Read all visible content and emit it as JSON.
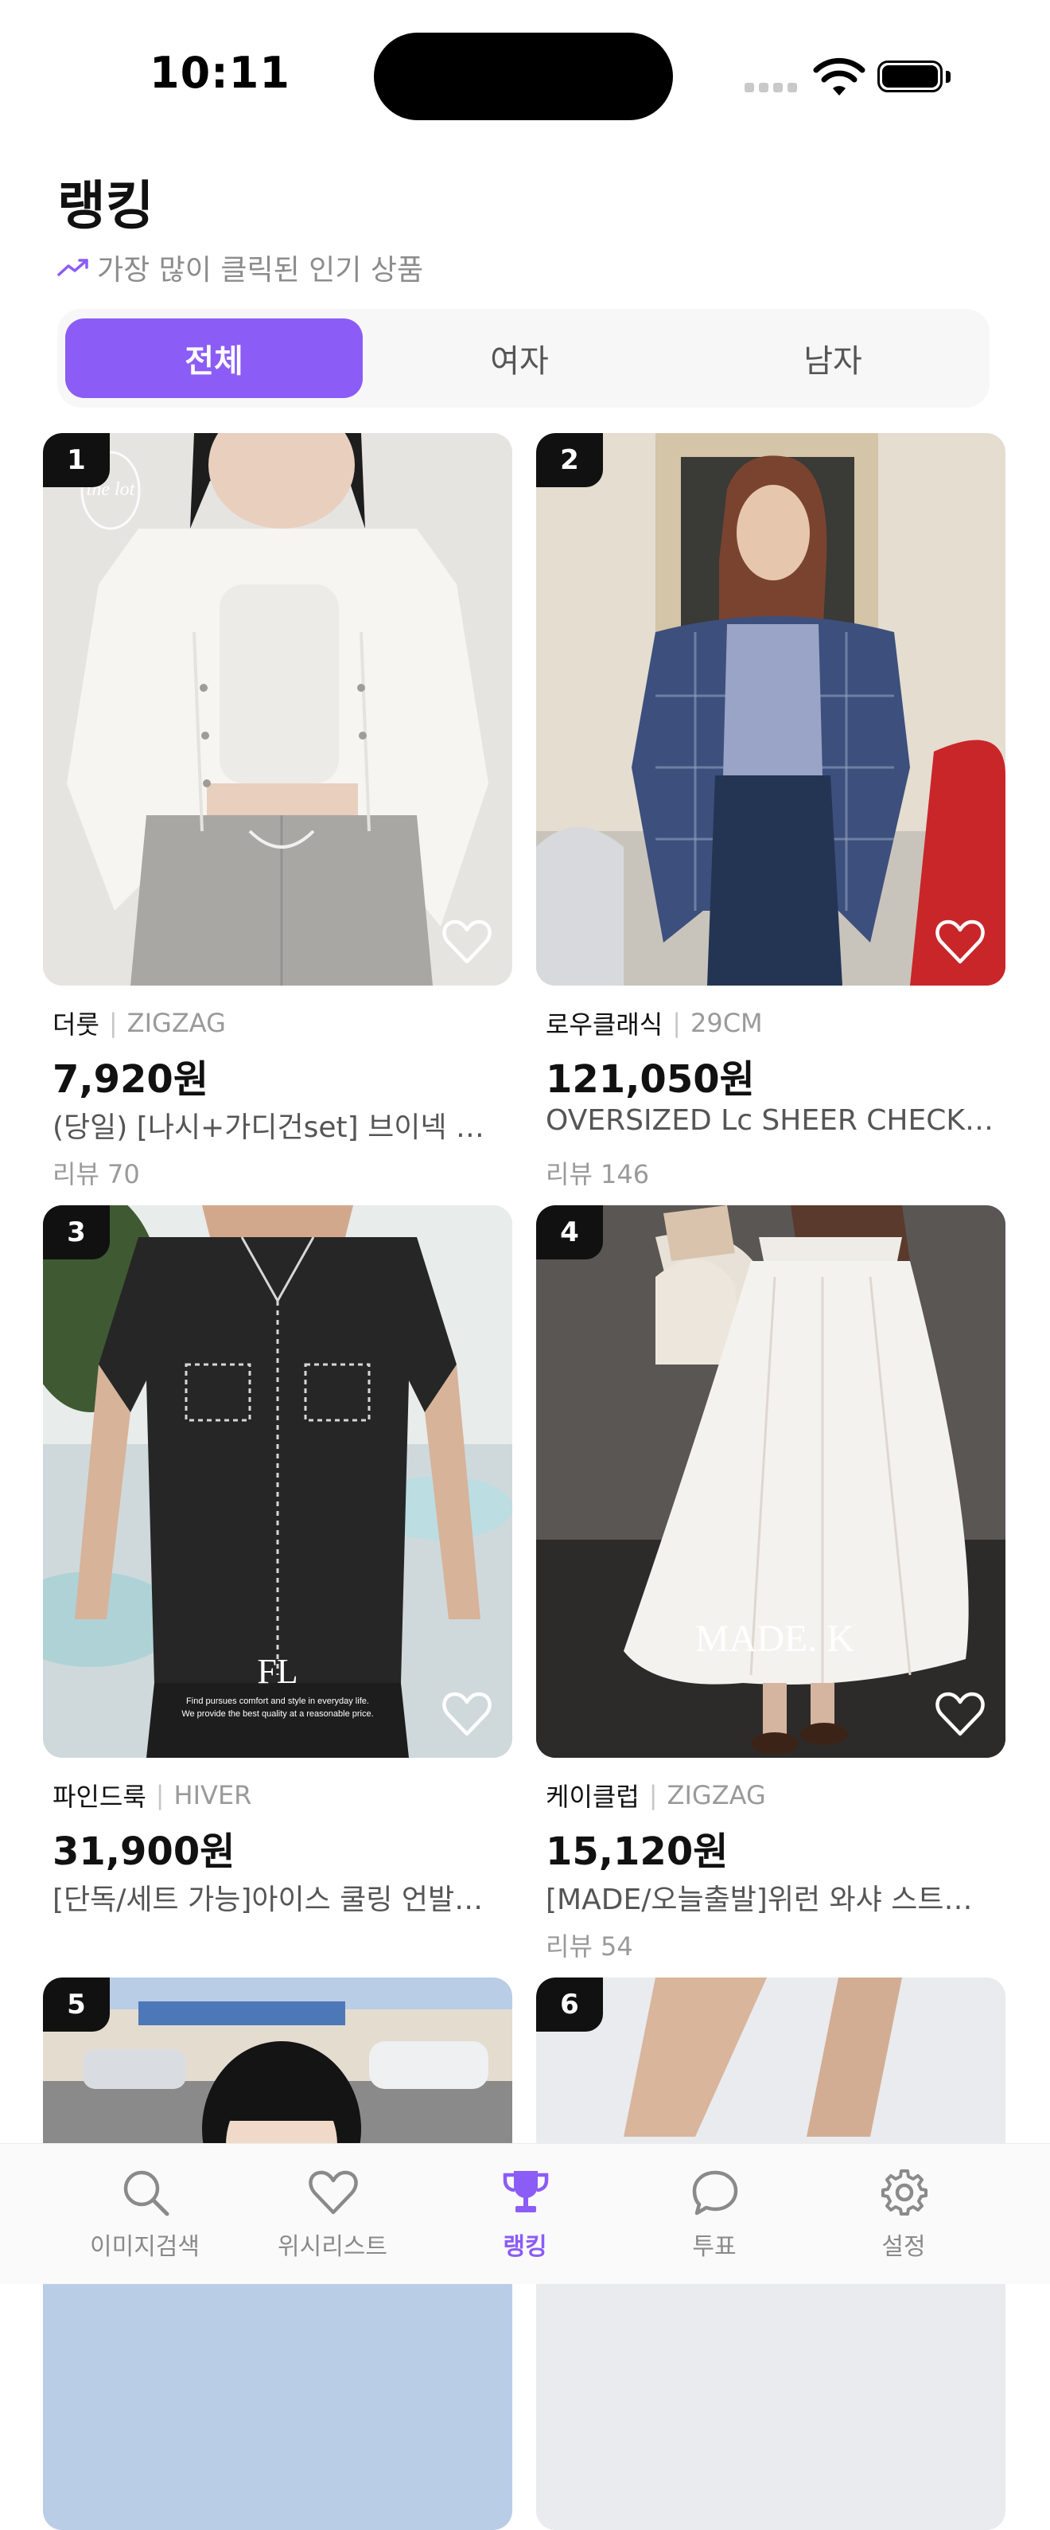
{
  "status_bar": {
    "time": "10:11"
  },
  "header": {
    "title": "랭킹",
    "subtitle": "가장 많이 클릭된 인기 상품",
    "subtitle_icon": "trending-up-icon"
  },
  "segments": [
    {
      "label": "전체",
      "active": true
    },
    {
      "label": "여자",
      "active": false
    },
    {
      "label": "남자",
      "active": false
    }
  ],
  "products": [
    {
      "rank": "1",
      "brand": "더룻",
      "store": "ZIGZAG",
      "price": "7,920원",
      "name": "(당일) [나시+가디건set] 브이넥 가디건 세트",
      "review": "리뷰 70"
    },
    {
      "rank": "2",
      "brand": "로우클래식",
      "store": "29CM",
      "price": "121,050원",
      "name": "OVERSIZED Lc SHEER CHECK SHIRT",
      "review": "리뷰 146"
    },
    {
      "rank": "3",
      "brand": "파인드룩",
      "store": "HIVER",
      "price": "31,900원",
      "name": "[단독/세트 가능]아이스 쿨링 언발란스 데님 셔츠",
      "review": ""
    },
    {
      "rank": "4",
      "brand": "케이클럽",
      "store": "ZIGZAG",
      "price": "15,120원",
      "name": "[MADE/오늘출발]위런 와샤 스트랩 롱스커트",
      "review": "리뷰 54"
    },
    {
      "rank": "5"
    },
    {
      "rank": "6"
    }
  ],
  "photo_overlays": {
    "p1_logo": "the lot",
    "p3_logo": "FL",
    "p3_caption_1": "Find pursues comfort and style in everyday life.",
    "p3_caption_2": "We provide the best quality at a reasonable price.",
    "p4_logo": "MADE. K"
  },
  "tab_bar": [
    {
      "label": "이미지검색",
      "icon": "search-icon",
      "active": false
    },
    {
      "label": "위시리스트",
      "icon": "heart-icon",
      "active": false
    },
    {
      "label": "랭킹",
      "icon": "trophy-icon",
      "active": true
    },
    {
      "label": "투표",
      "icon": "chat-bubble-icon",
      "active": false
    },
    {
      "label": "설정",
      "icon": "gear-icon",
      "active": false
    }
  ],
  "colors": {
    "accent": "#8b5cf6",
    "rank_badge": "#111111"
  }
}
